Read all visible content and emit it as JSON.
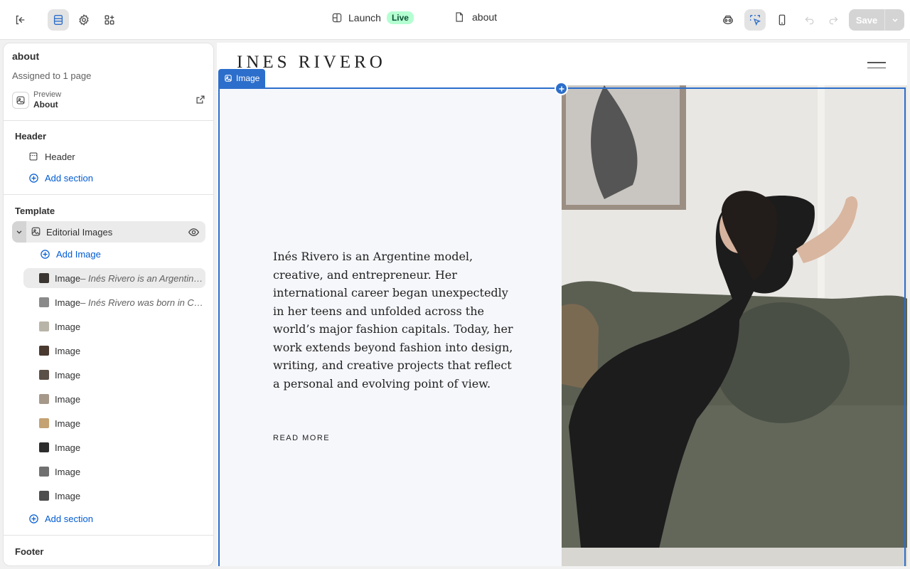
{
  "topbar": {
    "launch_label": "Launch",
    "live_badge": "Live",
    "page_name": "about",
    "save_label": "Save"
  },
  "sidebar": {
    "title": "about",
    "assigned": "Assigned to 1 page",
    "preview_label": "Preview",
    "preview_value": "About",
    "header_group": "Header",
    "header_item": "Header",
    "add_section": "Add section",
    "template_group": "Template",
    "section_name": "Editorial Images",
    "add_image": "Add Image",
    "blocks": [
      {
        "label": "Image",
        "subtitle": " – Inés Rivero is an Argentin…",
        "thumb": "#3b3631"
      },
      {
        "label": "Image",
        "subtitle": " – Inés Rivero was born in C…",
        "thumb": "#8a8a8a"
      },
      {
        "label": "Image",
        "subtitle": "",
        "thumb": "#b9b4a8"
      },
      {
        "label": "Image",
        "subtitle": "",
        "thumb": "#4a3a30"
      },
      {
        "label": "Image",
        "subtitle": "",
        "thumb": "#5a5048"
      },
      {
        "label": "Image",
        "subtitle": "",
        "thumb": "#a6998a"
      },
      {
        "label": "Image",
        "subtitle": "",
        "thumb": "#c4a272"
      },
      {
        "label": "Image",
        "subtitle": "",
        "thumb": "#2d2d2d"
      },
      {
        "label": "Image",
        "subtitle": "",
        "thumb": "#707070"
      },
      {
        "label": "Image",
        "subtitle": "",
        "thumb": "#4e4e4e"
      }
    ],
    "add_section_2": "Add section",
    "footer_group": "Footer"
  },
  "canvas": {
    "brand": "INES RIVERO",
    "selected_tag": "Image",
    "body_text": "Inés Rivero is an Argentine model, creative, and entrepreneur. Her international career began unexpectedly in her teens and unfolded across the world’s major fashion capitals. Today, her work extends beyond fashion into design, writing, and creative projects that reflect a personal and evolving point of view.",
    "read_more": "READ MORE"
  },
  "colors": {
    "accent": "#2c6ecb",
    "link": "#005bd3",
    "live_bg": "#b4fed2"
  }
}
